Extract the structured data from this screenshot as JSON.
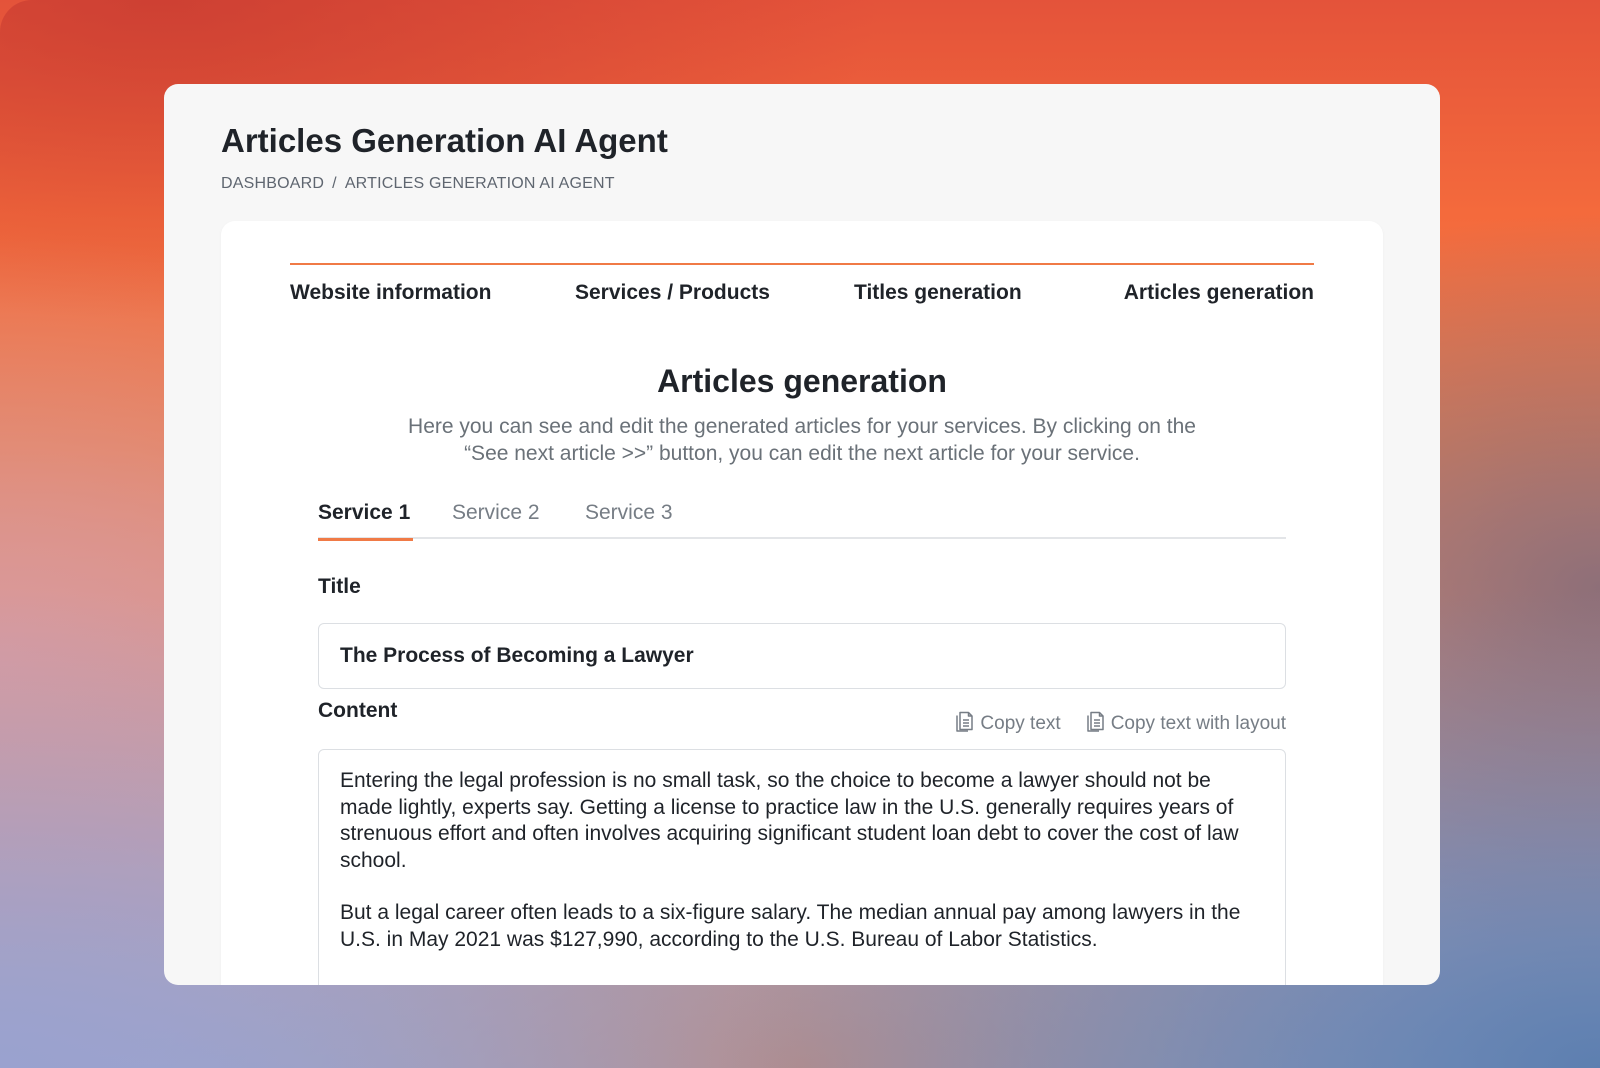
{
  "header": {
    "title": "Articles Generation AI Agent",
    "breadcrumb": [
      "DASHBOARD",
      "/",
      "ARTICLES GENERATION AI AGENT"
    ]
  },
  "stepper": {
    "steps": [
      "Website information",
      "Services / Products",
      "Titles generation",
      "Articles generation"
    ],
    "active_step": "Articles generation"
  },
  "section": {
    "title": "Articles generation",
    "description": "Here you can see and edit the generated articles for your services. By clicking on the “See next article >>” button, you can edit the next article for your service."
  },
  "tabs": {
    "items": [
      "Service 1",
      "Service 2",
      "Service 3"
    ],
    "active": "Service 1"
  },
  "form": {
    "title_label": "Title",
    "title_value": "The Process of Becoming a Lawyer",
    "content_label": "Content",
    "copy_text_label": "Copy text",
    "copy_layout_label": "Copy text with layout",
    "content_paragraphs": [
      "Entering the legal profession is no small task, so the choice to become a lawyer should not be made lightly, experts say. Getting a license to practice law in the U.S. generally requires years of strenuous effort and often involves acquiring significant student loan debt to cover the cost of law school.",
      "But a legal career often leads to a six-figure salary. The median annual pay among lawyers in the U.S. in May 2021 was $127,990, according to the U.S. Bureau of Labor Statistics."
    ]
  },
  "colors": {
    "accent": "#f07a46",
    "text_primary": "#1f2329",
    "text_muted": "#6a7178"
  },
  "icons": {
    "copy": "copy-document-icon"
  }
}
